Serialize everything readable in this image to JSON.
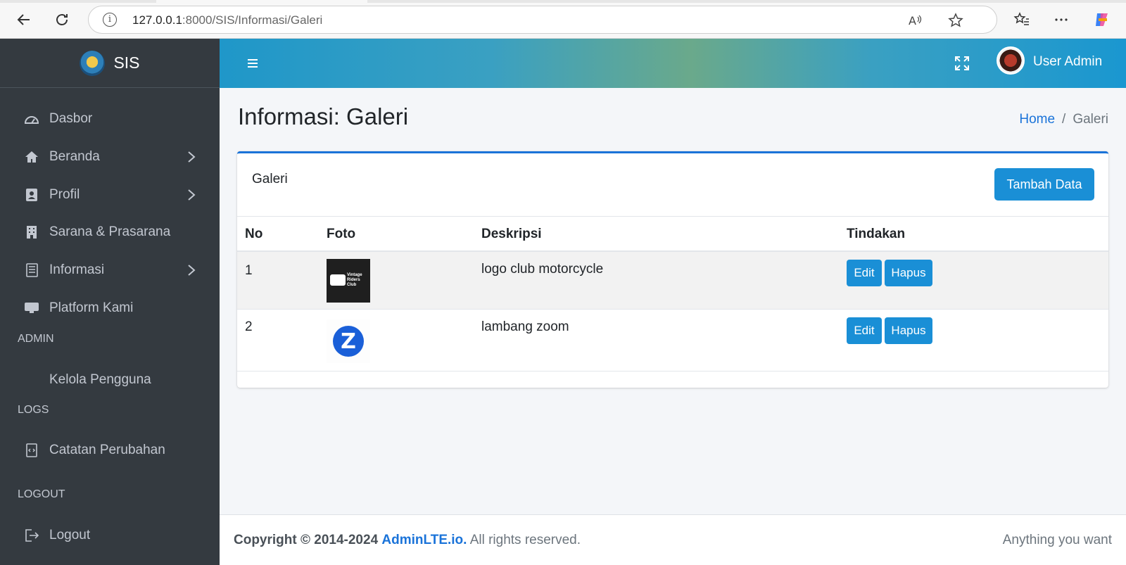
{
  "browser": {
    "url_host": "127.0.0.1",
    "url_rest": ":8000/SIS/Informasi/Galeri"
  },
  "sidebar": {
    "brand": "SIS",
    "items": [
      {
        "label": "Dasbor",
        "icon": "gauge-icon"
      },
      {
        "label": "Beranda",
        "icon": "home-icon"
      },
      {
        "label": "Profil",
        "icon": "id-card-icon"
      },
      {
        "label": "Sarana & Prasarana",
        "icon": "building-icon"
      },
      {
        "label": "Informasi",
        "icon": "news-icon"
      },
      {
        "label": "Platform Kami",
        "icon": "monitor-icon"
      }
    ],
    "header_admin": "ADMIN",
    "kelola": "Kelola Pengguna",
    "header_logs": "LOGS",
    "catatan": "Catatan Perubahan",
    "header_logout": "LOGOUT",
    "logout": "Logout"
  },
  "topnav": {
    "user_name": "User Admin"
  },
  "content": {
    "page_title": "Informasi: Galeri",
    "breadcrumb_home": "Home",
    "breadcrumb_sep": "/",
    "breadcrumb_current": "Galeri"
  },
  "card": {
    "title": "Galeri",
    "add_button": "Tambah Data",
    "columns": [
      "No",
      "Foto",
      "Deskripsi",
      "Tindakan"
    ],
    "rows": [
      {
        "no": "1",
        "thumb_text": "Vintage Riders Club",
        "desc": "logo club motorcycle",
        "edit": "Edit",
        "delete": "Hapus"
      },
      {
        "no": "2",
        "thumb_text": "Z",
        "desc": "lambang zoom",
        "edit": "Edit",
        "delete": "Hapus"
      }
    ]
  },
  "footer": {
    "copyright": "Copyright © 2014-2024",
    "brand_link": "AdminLTE.io.",
    "rights": "All rights reserved.",
    "right_text": "Anything you want"
  },
  "colors": {
    "sidebar_bg": "#343a40",
    "primary": "#1a8fd6",
    "link": "#1a73d9"
  }
}
